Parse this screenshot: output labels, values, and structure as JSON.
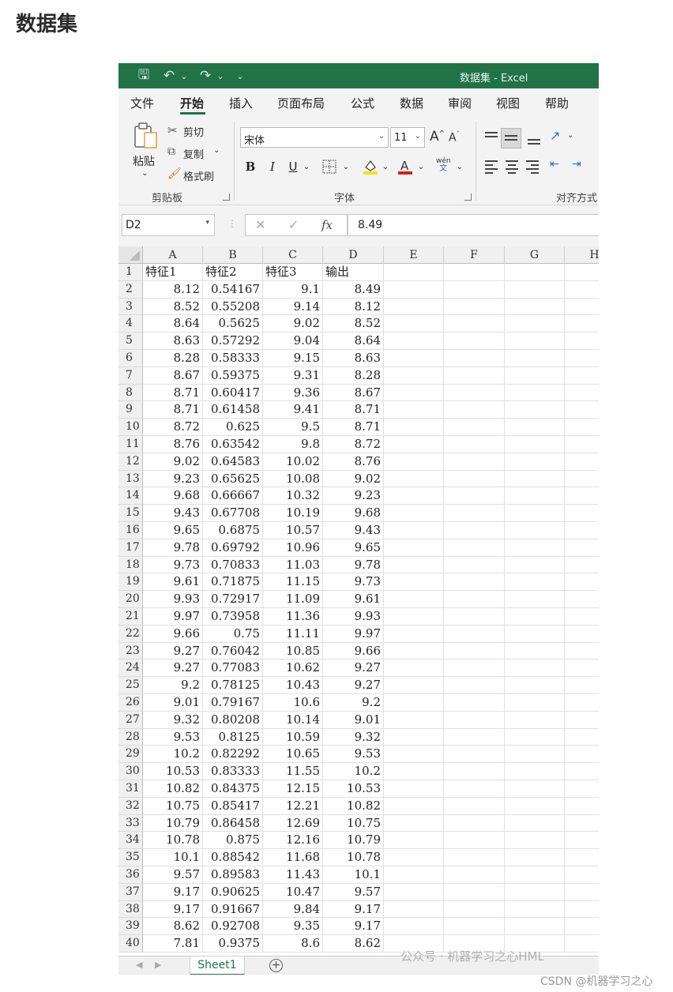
{
  "page": {
    "heading": "数据集"
  },
  "excel": {
    "window_title": "数据集 - Excel",
    "quick_access": {
      "save": "🖫",
      "undo": "↶",
      "undo_dd": "⌄",
      "redo": "↷",
      "redo_dd": "⌄",
      "customize": "⌄"
    },
    "menu": [
      "文件",
      "开始",
      "插入",
      "页面布局",
      "公式",
      "数据",
      "审阅",
      "视图",
      "帮助"
    ],
    "active_menu": "开始",
    "ribbon": {
      "clipboard": {
        "paste": "粘贴",
        "cut": "剪切",
        "copy": "复制",
        "format_painter": "格式刷",
        "label": "剪贴板"
      },
      "font": {
        "name": "宋体",
        "size": "11",
        "label": "字体",
        "bold": "B",
        "italic": "I",
        "underline": "U",
        "grow": "A",
        "shrink": "A",
        "phonetic": "wén",
        "phonetic_sub": "文"
      },
      "alignment": {
        "label": "对齐方式"
      }
    },
    "formula_bar": {
      "name_box": "D2",
      "value": "8.49",
      "fx": "fx",
      "cancel": "✕",
      "enter": "✓"
    },
    "columns": [
      "A",
      "B",
      "C",
      "D",
      "E",
      "F",
      "G",
      "H"
    ],
    "header_row": [
      "特征1",
      "特征2",
      "特征3",
      "输出"
    ],
    "rows": [
      [
        "8.12",
        "0.54167",
        "9.1",
        "8.49"
      ],
      [
        "8.52",
        "0.55208",
        "9.14",
        "8.12"
      ],
      [
        "8.64",
        "0.5625",
        "9.02",
        "8.52"
      ],
      [
        "8.63",
        "0.57292",
        "9.04",
        "8.64"
      ],
      [
        "8.28",
        "0.58333",
        "9.15",
        "8.63"
      ],
      [
        "8.67",
        "0.59375",
        "9.31",
        "8.28"
      ],
      [
        "8.71",
        "0.60417",
        "9.36",
        "8.67"
      ],
      [
        "8.71",
        "0.61458",
        "9.41",
        "8.71"
      ],
      [
        "8.72",
        "0.625",
        "9.5",
        "8.71"
      ],
      [
        "8.76",
        "0.63542",
        "9.8",
        "8.72"
      ],
      [
        "9.02",
        "0.64583",
        "10.02",
        "8.76"
      ],
      [
        "9.23",
        "0.65625",
        "10.08",
        "9.02"
      ],
      [
        "9.68",
        "0.66667",
        "10.32",
        "9.23"
      ],
      [
        "9.43",
        "0.67708",
        "10.19",
        "9.68"
      ],
      [
        "9.65",
        "0.6875",
        "10.57",
        "9.43"
      ],
      [
        "9.78",
        "0.69792",
        "10.96",
        "9.65"
      ],
      [
        "9.73",
        "0.70833",
        "11.03",
        "9.78"
      ],
      [
        "9.61",
        "0.71875",
        "11.15",
        "9.73"
      ],
      [
        "9.93",
        "0.72917",
        "11.09",
        "9.61"
      ],
      [
        "9.97",
        "0.73958",
        "11.36",
        "9.93"
      ],
      [
        "9.66",
        "0.75",
        "11.11",
        "9.97"
      ],
      [
        "9.27",
        "0.76042",
        "10.85",
        "9.66"
      ],
      [
        "9.27",
        "0.77083",
        "10.62",
        "9.27"
      ],
      [
        "9.2",
        "0.78125",
        "10.43",
        "9.27"
      ],
      [
        "9.01",
        "0.79167",
        "10.6",
        "9.2"
      ],
      [
        "9.32",
        "0.80208",
        "10.14",
        "9.01"
      ],
      [
        "9.53",
        "0.8125",
        "10.59",
        "9.32"
      ],
      [
        "10.2",
        "0.82292",
        "10.65",
        "9.53"
      ],
      [
        "10.53",
        "0.83333",
        "11.55",
        "10.2"
      ],
      [
        "10.82",
        "0.84375",
        "12.15",
        "10.53"
      ],
      [
        "10.75",
        "0.85417",
        "12.21",
        "10.82"
      ],
      [
        "10.79",
        "0.86458",
        "12.69",
        "10.75"
      ],
      [
        "10.78",
        "0.875",
        "12.16",
        "10.79"
      ],
      [
        "10.1",
        "0.88542",
        "11.68",
        "10.78"
      ],
      [
        "9.57",
        "0.89583",
        "11.43",
        "10.1"
      ],
      [
        "9.17",
        "0.90625",
        "10.47",
        "9.57"
      ],
      [
        "9.17",
        "0.91667",
        "9.84",
        "9.17"
      ],
      [
        "8.62",
        "0.92708",
        "9.35",
        "9.17"
      ],
      [
        "7.81",
        "0.9375",
        "8.6",
        "8.62"
      ]
    ],
    "sheet_tab": "Sheet1",
    "add_sheet": "+",
    "nav": {
      "prev": "◀",
      "next": "▶"
    }
  },
  "watermark": "公众号 · 机器学习之心HML",
  "footer_mark": "CSDN @机器学习之心",
  "colors": {
    "excel_green": "#217346",
    "ribbon_bg": "#f3f3f3"
  }
}
